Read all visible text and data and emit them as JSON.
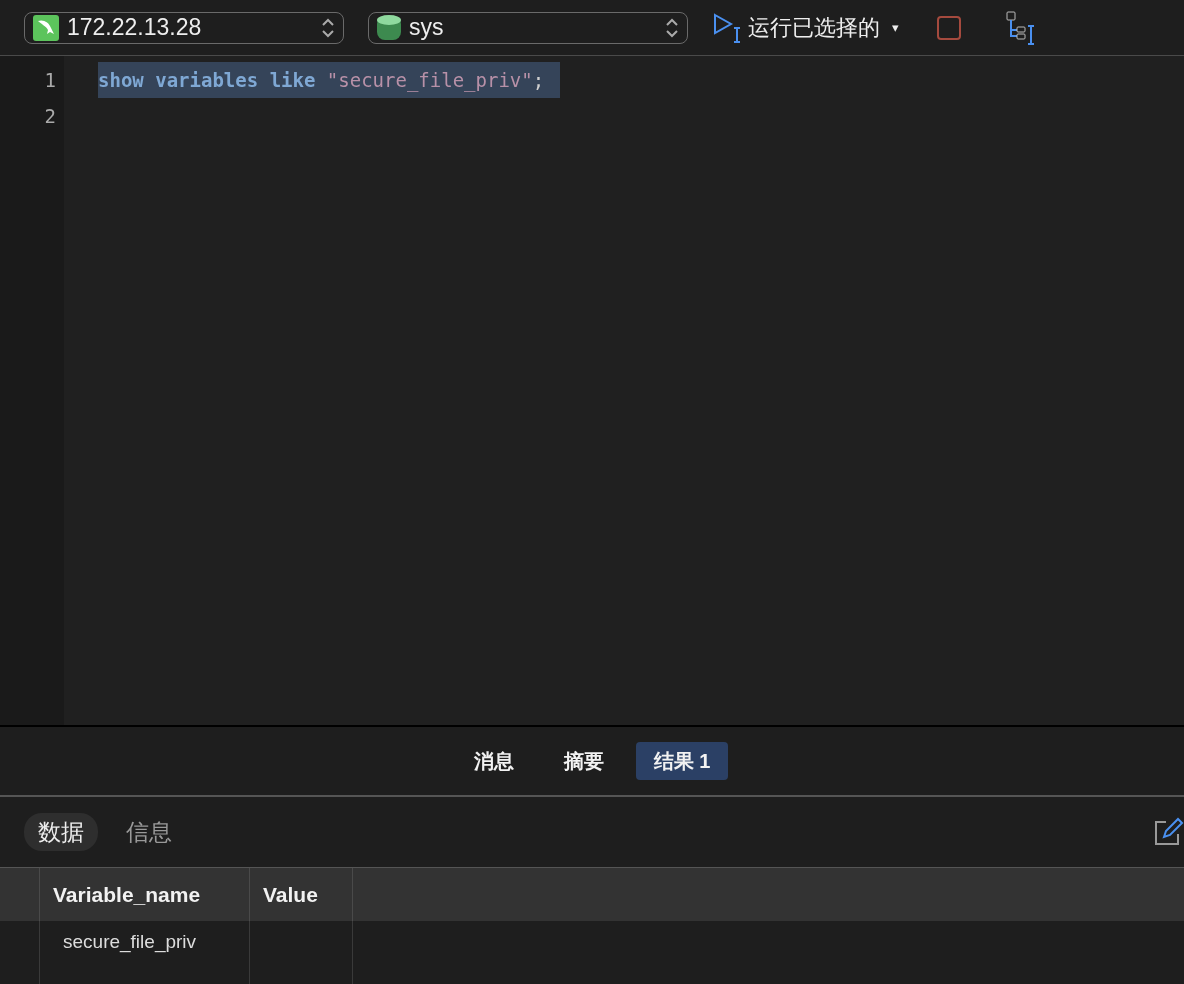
{
  "toolbar": {
    "connection": "172.22.13.28",
    "database": "sys",
    "run_label": "运行已选择的",
    "run_caret": "▾"
  },
  "editor": {
    "lines": [
      {
        "number": "1",
        "selected": true,
        "tokens": [
          {
            "kind": "keyword",
            "text": "show"
          },
          {
            "kind": "keyword",
            "text": "variables"
          },
          {
            "kind": "keyword",
            "text": "like"
          },
          {
            "kind": "string",
            "text": "\"secure_file_priv\""
          },
          {
            "kind": "plain",
            "text": ";"
          }
        ]
      },
      {
        "number": "2"
      }
    ]
  },
  "result_tabs": [
    {
      "label": "消息",
      "selected": false
    },
    {
      "label": "摘要",
      "selected": false
    },
    {
      "label": "结果 1",
      "selected": true
    }
  ],
  "view_tabs": [
    {
      "label": "数据",
      "selected": true
    },
    {
      "label": "信息",
      "selected": false
    }
  ],
  "table": {
    "columns": [
      "Variable_name",
      "Value"
    ],
    "rows": [
      [
        "secure_file_priv",
        ""
      ]
    ]
  }
}
